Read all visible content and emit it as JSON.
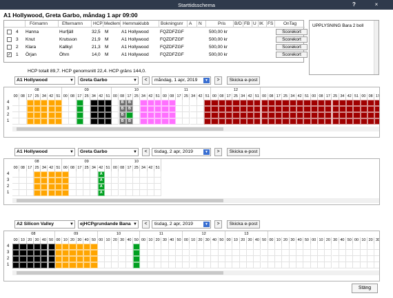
{
  "window": {
    "title": "Starttidsschema",
    "help": "?",
    "close": "×"
  },
  "heading": "A1 Hollywood, Greta Garbo, måndag 1 apr 09:00",
  "columns": [
    "Förnamn",
    "Efternamn",
    "HCP",
    "Medlem",
    "Hemmaklubb",
    "Bokningsnr",
    "A",
    "N",
    "Pris",
    "B/D",
    "FB",
    "U",
    "IK",
    "FS",
    "OnTag"
  ],
  "players": [
    {
      "num": "4",
      "first": "Hanna",
      "last": "Hurfjäll",
      "hcp": "32,5",
      "member": "M",
      "club": "A1 Hollywood",
      "booking": "FQZDFZGF",
      "price": "500,00 kr",
      "checked": false,
      "action": "Scorekort"
    },
    {
      "num": "3",
      "first": "Knut",
      "last": "Krutsson",
      "hcp": "21,9",
      "member": "M",
      "club": "A1 Hollywood",
      "booking": "FQZDFZGF",
      "price": "500,00 kr",
      "checked": false,
      "action": "Scorekort"
    },
    {
      "num": "2",
      "first": "Klara",
      "last": "Kallkyl",
      "hcp": "21,3",
      "member": "M",
      "club": "A1 Hollywood",
      "booking": "FQZDFZGF",
      "price": "500,00 kr",
      "checked": false,
      "action": "Scorekort"
    },
    {
      "num": "1",
      "first": "Örjan",
      "last": "Öhrn",
      "hcp": "14,0",
      "member": "M",
      "club": "A1 Hollywood",
      "booking": "FQZDFZGF",
      "price": "500,00 kr",
      "checked": true,
      "action": "Scorekort"
    }
  ],
  "info_text": "UPPLYSNING Bara 2 boll",
  "stats": "HCP totalt 89,7.  HCP genomsnitt 22,4.  HCP gräns 144,0.",
  "panels": [
    {
      "club": "A1 Hollywood",
      "course": "Greta Garbo",
      "date": "måndag, 1 apr, 2019",
      "email": "Skicka e-post",
      "hours": [
        "08",
        "09",
        "10",
        "11",
        "12"
      ],
      "mins": [
        "00",
        "08",
        "17",
        "25",
        "34",
        "42",
        "51"
      ],
      "rows": [
        "4",
        "3",
        "2",
        "1"
      ],
      "colors": {
        "orange": "#ffa500",
        "green": "#00a020",
        "black": "#000000",
        "gray": "#707070",
        "pink": "#ff70ff",
        "red": "#a00000"
      }
    },
    {
      "club": "A1 Hollywood",
      "course": "Greta Garbo",
      "date": "tisdag, 2 apr, 2019",
      "email": "Skicka e-post",
      "hours": [
        "08",
        "09",
        "10"
      ],
      "mins": [
        "00",
        "08",
        "17",
        "25",
        "34",
        "42",
        "51"
      ],
      "rows": [
        "4",
        "3",
        "2",
        "1"
      ]
    },
    {
      "club": "A2 Silicon Valley",
      "course": "ejHCPgrundande Bana",
      "date": "tisdag, 2 apr, 2019",
      "email": "Skicka e-post",
      "hours": [
        "08",
        "09",
        "10",
        "11",
        "12",
        "13"
      ],
      "mins": [
        "00",
        "10",
        "20",
        "30",
        "40",
        "50"
      ],
      "rows": [
        "4",
        "3",
        "2",
        "1"
      ]
    }
  ],
  "block_letters": {
    "b": "B",
    "a": "A"
  },
  "nav": {
    "prev": "<",
    "next": ">"
  },
  "close_label": "Stäng"
}
